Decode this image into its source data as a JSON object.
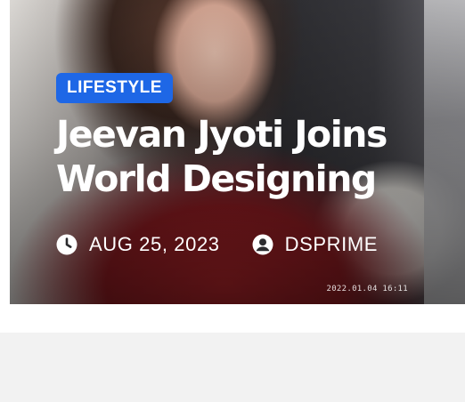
{
  "post": {
    "category": "LIFESTYLE",
    "title": "Jeevan Jyoti Joins World Designing",
    "date": "AUG 25, 2023",
    "author": "DSPRIME",
    "photo_timestamp": "2022.01.04 16:11"
  },
  "colors": {
    "badge": "#1e67e6",
    "text": "#ffffff",
    "page_background": "#f2f2f2"
  },
  "icons": {
    "date": "clock-icon",
    "author": "user-circle-icon"
  }
}
